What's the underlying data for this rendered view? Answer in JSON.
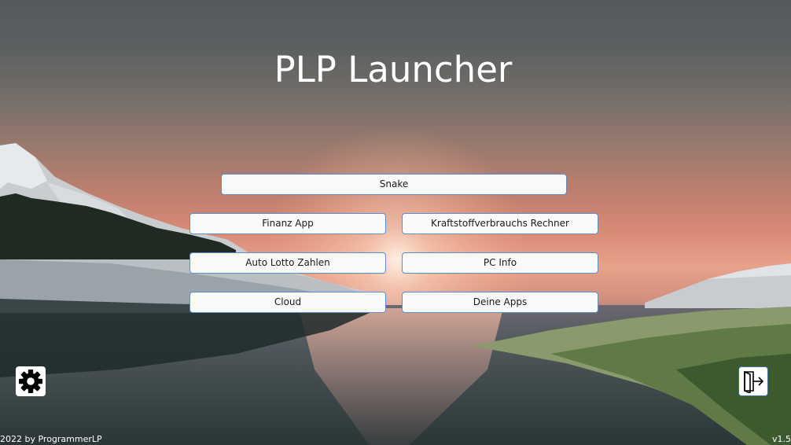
{
  "app": {
    "title": "PLP Launcher"
  },
  "buttons": {
    "snake": "Snake",
    "finanz": "Finanz App",
    "kraftstoff": "Kraftstoffverbrauchs Rechner",
    "lotto": "Auto Lotto Zahlen",
    "pcinfo": "PC Info",
    "cloud": "Cloud",
    "deineapps": "Deine Apps"
  },
  "icons": {
    "settings": "gear-icon",
    "exit": "exit-door-icon"
  },
  "footer": {
    "copyright": "2022 by ProgrammerLP",
    "version": "v1.5"
  },
  "colors": {
    "button_bg": "#f9f9f9",
    "button_border": "#5b8fc9",
    "title_text": "#ffffff"
  }
}
